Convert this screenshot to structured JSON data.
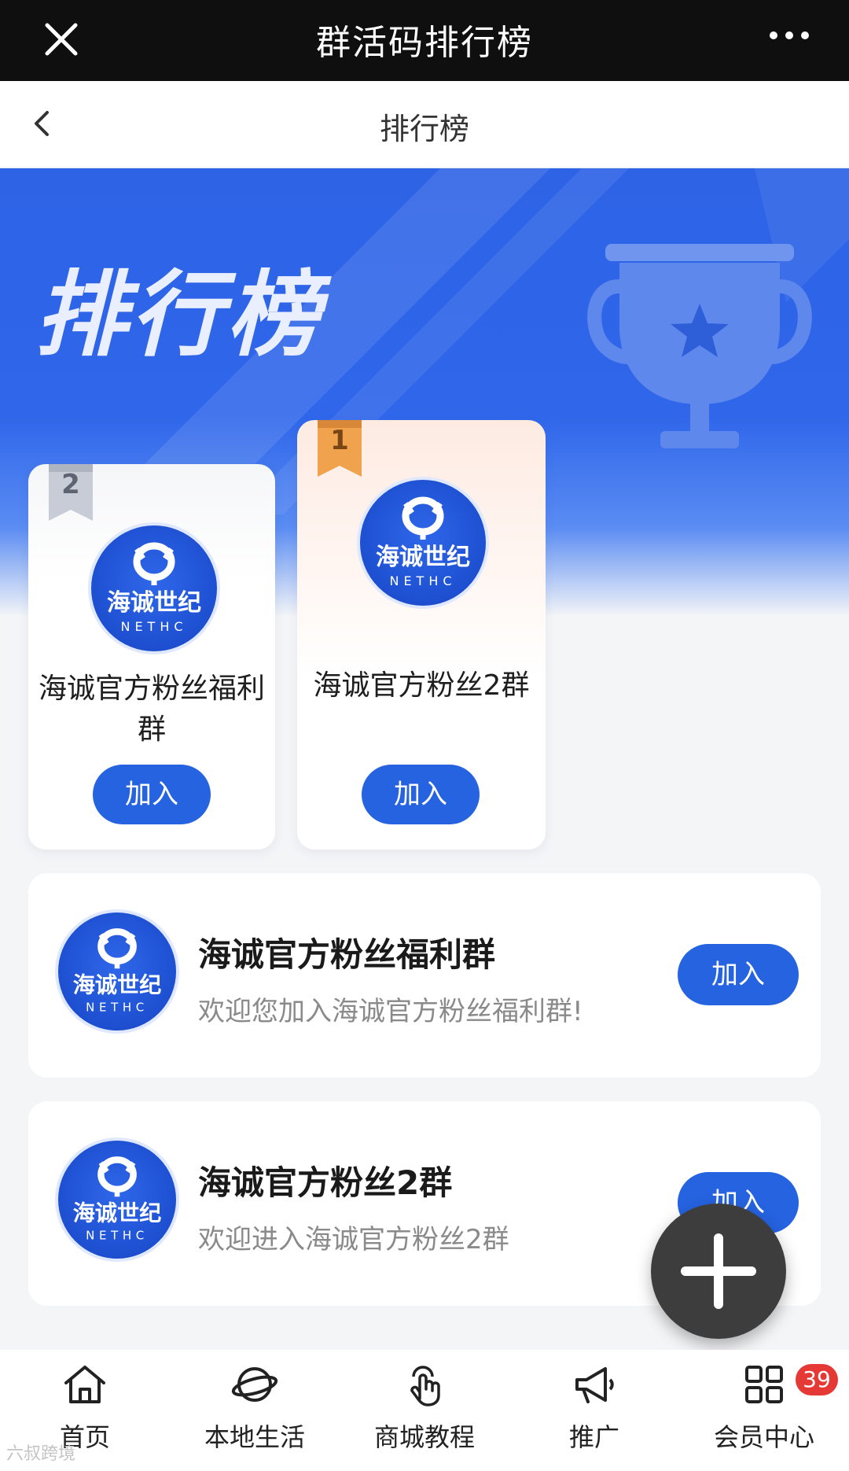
{
  "topbar": {
    "title": "群活码排行榜"
  },
  "navbar": {
    "title": "排行榜"
  },
  "banner": {
    "title": "排行榜"
  },
  "podium": [
    {
      "rank": "2",
      "name": "海诚官方粉丝福利群",
      "join_label": "加入"
    },
    {
      "rank": "1",
      "name": "海诚官方粉丝2群",
      "join_label": "加入"
    }
  ],
  "logo": {
    "cn_text": "海诚世纪",
    "en_text": "NETHC"
  },
  "list": [
    {
      "name": "海诚官方粉丝福利群",
      "desc": "欢迎您加入海诚官方粉丝福利群!",
      "join_label": "加入"
    },
    {
      "name": "海诚官方粉丝2群",
      "desc": "欢迎进入海诚官方粉丝2群",
      "join_label": "加入"
    }
  ],
  "tabs": [
    {
      "label": "首页",
      "icon": "home-icon"
    },
    {
      "label": "本地生活",
      "icon": "planet-icon"
    },
    {
      "label": "商城教程",
      "icon": "touch-icon"
    },
    {
      "label": "推广",
      "icon": "megaphone-icon"
    },
    {
      "label": "会员中心",
      "icon": "grid-icon"
    }
  ],
  "member_badge": "39",
  "watermark": "六叔跨境",
  "colors": {
    "accent": "#2563e0",
    "banner": "#2f66ea",
    "topbar": "#0f0f0f",
    "badge": "#e53935"
  }
}
